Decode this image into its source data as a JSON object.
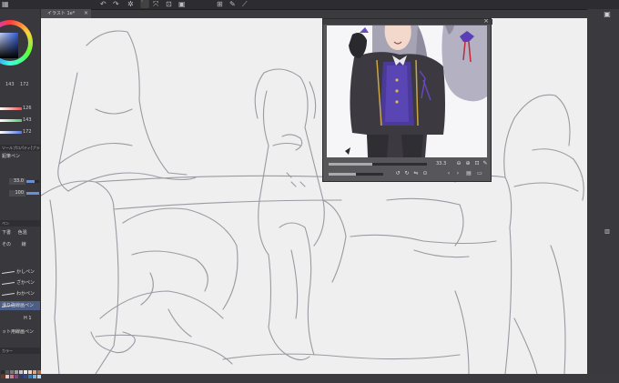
{
  "app": {
    "doc_tab": "イラスト 1e*",
    "doc_tab_close": "×",
    "top_icons": [
      "undo-icon",
      "redo-icon",
      "clear-icon",
      "fill-icon",
      "transform-icon",
      "crop-icon",
      "select-icon",
      "ruler-icon",
      "pen-mode-icon"
    ]
  },
  "color": {
    "main": "#2f5bd8",
    "hsv": [
      "143",
      "172"
    ],
    "rgb": [
      {
        "value": "126",
        "color": "#e05555"
      },
      {
        "value": "143",
        "color": "#55c86a"
      },
      {
        "value": "172",
        "color": "#5576e0"
      }
    ]
  },
  "tool_panel": {
    "header": "ツールプロパティ[ブラシ]",
    "sub_tool": "鉛筆ペン",
    "size_value": "33.0",
    "opacity_value": "100"
  },
  "brush_panel": {
    "header": "ペン",
    "row1": [
      "下書",
      "色混"
    ],
    "row2": [
      "その",
      "線"
    ],
    "items": [
      "かしペン",
      "ざかペン",
      "わかペン",
      "滑り強線画ペン",
      "H 1",
      "ット用線画ペン"
    ],
    "selected_index": 3,
    "color_label": "カラー"
  },
  "reference_window": {
    "close": "×",
    "zoom": "33.3",
    "controls": [
      "zoom-out-icon",
      "zoom-in-icon",
      "fit-icon",
      "eyedropper-icon",
      "rotate-left-icon",
      "rotate-right-icon",
      "flip-icon",
      "pin-icon",
      "prev-icon",
      "next-icon",
      "image-icon"
    ]
  },
  "right_icons": [
    "canvas-icon",
    "layer-icon"
  ],
  "palette": [
    "#2a2a2a",
    "#555",
    "#7a7a7a",
    "#a0a0a0",
    "#c8c8c8",
    "#e8e8e8",
    "#f2d4c2",
    "#e0a882",
    "#b06a48",
    "#6a3a28",
    "#e9c3c9",
    "#c67b89",
    "#7c4a82",
    "#3a3366",
    "#294a8a",
    "#3a7ab8",
    "#7bb6d8",
    "#b8d8e8"
  ]
}
